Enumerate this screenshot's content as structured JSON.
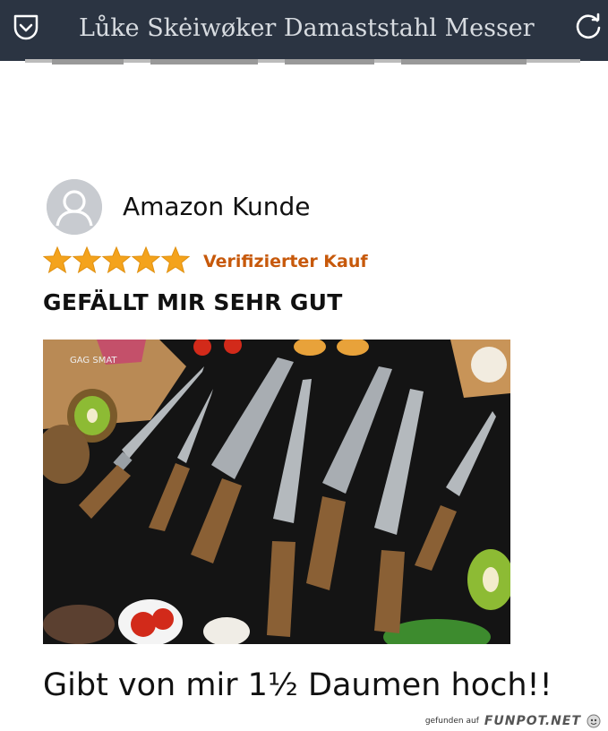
{
  "header": {
    "title": "Lůke Skėiwøker Damaststahl Messer Set",
    "left_icon": "pocket-save-icon",
    "right_icon": "reload-icon"
  },
  "review": {
    "reviewer_name": "Amazon Kunde",
    "rating": 5,
    "rating_max": 5,
    "verified_label": "Verifizierter Kauf",
    "headline": "GEFÄLLT MIR SEHR GUT",
    "image": {
      "subject": "damascus-knife-set-photo",
      "watermark_text": "GAG SMAT"
    },
    "caption": "Gibt von mir 1½ Daumen hoch!!"
  },
  "footer": {
    "prefix": "gefunden auf",
    "site": "FUNPOT.NET"
  },
  "colors": {
    "topbar": "#2b3442",
    "star": "#f4a31c",
    "verified": "#c7590b"
  }
}
